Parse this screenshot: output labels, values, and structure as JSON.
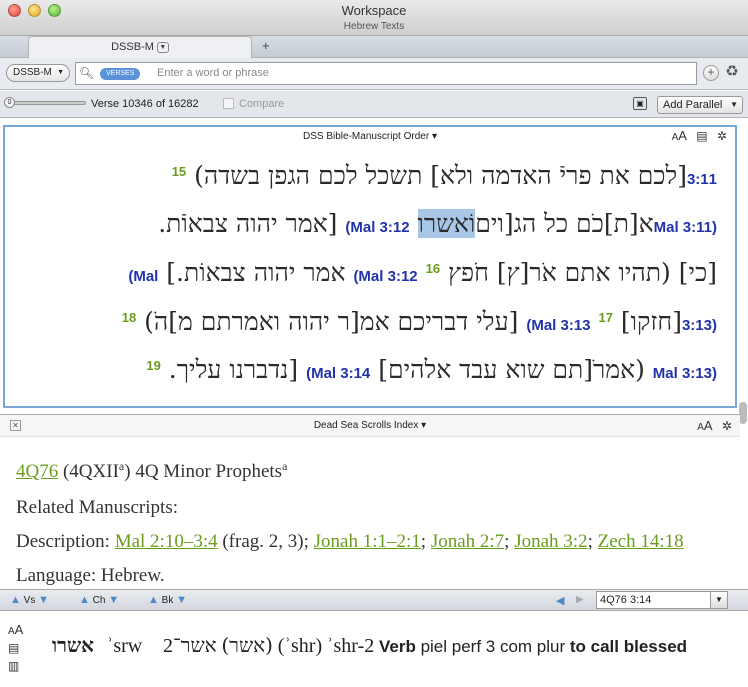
{
  "window": {
    "title": "Workspace",
    "subtitle": "Hebrew Texts"
  },
  "tabs": [
    {
      "label": "DSSB-M"
    }
  ],
  "search": {
    "resource": "DSSB-M",
    "scope_pill": "VERSES",
    "placeholder": "Enter a word or phrase"
  },
  "nav": {
    "verse_text": "Verse 10346 of 16282",
    "compare_label": "Compare",
    "add_parallel_label": "Add Parallel"
  },
  "panel1": {
    "title": "DSS Bible-Manuscript Order",
    "lines": [
      {
        "vn": "15",
        "hebrew": "[לכם את פריֿ האדמה ולא] תשכל לכם הגפן בשדה)",
        "ref": "3:11"
      },
      {
        "hebrew_a": "[אמר יהוה צבאוֿת.",
        "ref_mid": "(Mal 3:12",
        "hebrew_b": "וֹאשרו",
        "hebrew_c": "א[ת]כֹם כל הג[וים",
        "ref": "Mal 3:11)"
      },
      {
        "ref_left": "(Mal",
        "hebrew_a": "אמר יהוה צבאוֹת.]",
        "vn": "16",
        "ref_mid": "(Mal 3:12",
        "hebrew_b": "[כי] (תהיו אתם אֹר[ץ] חֹפץ",
        "ref": ""
      },
      {
        "vn2": "18",
        "hebrew_a": "[עלי דבריכם אמ[ר יהוה ואמרתם מ]הֹ)",
        "ref_mid": "(Mal 3:13",
        "vn": "17",
        "hebrew_b": "[חזקו]",
        "ref": "3:13)"
      },
      {
        "vn2": "19",
        "hebrew_a": "[נדברנו עליך.",
        "ref_mid": "(Mal 3:14",
        "hebrew_b": "(אמרֹ[תם שוא עבד אלהים]",
        "ref": "Mal 3:13)"
      }
    ]
  },
  "panel2": {
    "title": "Dead Sea Scrolls Index",
    "ms_link": "4Q76",
    "ms_paren": "(4QXII",
    "ms_paren_sup": "a",
    "ms_paren_close": ")",
    "ms_name": "4Q Minor Prophets",
    "ms_name_sup": "a",
    "related_label": "Related Manuscripts:",
    "description_label": "Description:",
    "desc_links": [
      "Mal 2:10–3:4",
      "Jonah 1:1–2:1",
      "Jonah 2:7",
      "Jonah 3:2",
      "Zech 14:18"
    ],
    "desc_frag": "(frag. 2, 3);",
    "language_text": "Language: Hebrew."
  },
  "bottombar": {
    "vs": "Vs",
    "ch": "Ch",
    "bk": "Bk",
    "ref_value": "4Q76 3:14"
  },
  "info": {
    "word": "אשרו",
    "translit1": "ʾsrw",
    "lemma_num": "2",
    "lemma": "אשר־",
    "lemma_paren": "(אשר)",
    "translit2": "(ʾshr)",
    "translit3": "ʾshr-2",
    "pos": "Verb",
    "parse": "piel perf 3 com plur",
    "gloss": "to call blessed"
  },
  "colors": {
    "accent": "#7aa7d6",
    "link": "#6a9c1e",
    "ref": "#2233aa"
  }
}
